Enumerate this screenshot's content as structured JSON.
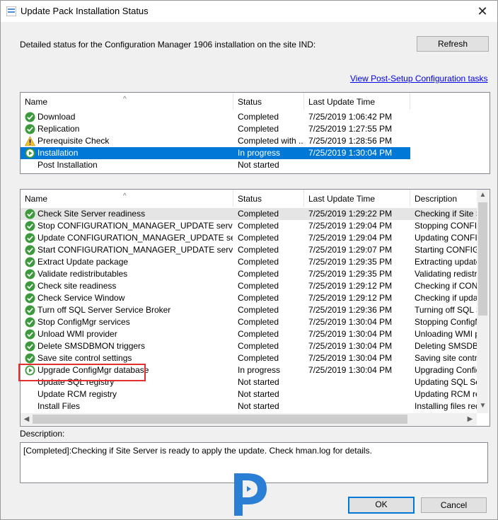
{
  "window": {
    "title": "Update Pack Installation Status",
    "close_glyph": "✕"
  },
  "status_text": "Detailed status for the Configuration Manager 1906 installation on the site IND:",
  "refresh_label": "Refresh",
  "post_setup_link": "View Post-Setup Configuration tasks",
  "top_list": {
    "columns": [
      "Name",
      "Status",
      "Last Update Time"
    ],
    "rows": [
      {
        "name": "Download",
        "status": "Completed",
        "time": "7/25/2019 1:06:42 PM",
        "icon": "check-icon"
      },
      {
        "name": "Replication",
        "status": "Completed",
        "time": "7/25/2019 1:27:55 PM",
        "icon": "check-icon"
      },
      {
        "name": "Prerequisite Check",
        "status": "Completed with ...",
        "time": "7/25/2019 1:28:56 PM",
        "icon": "warning-icon"
      },
      {
        "name": "Installation",
        "status": "In progress",
        "time": "7/25/2019 1:30:04 PM",
        "icon": "play-icon"
      },
      {
        "name": "Post Installation",
        "status": "Not started",
        "time": "",
        "icon": ""
      }
    ]
  },
  "bottom_list": {
    "columns": [
      "Name",
      "Status",
      "Last Update Time",
      "Description"
    ],
    "rows": [
      {
        "name": "Check Site Server readiness",
        "status": "Completed",
        "time": "7/25/2019 1:29:22 PM",
        "desc": "Checking if Site Se",
        "icon": "check-icon"
      },
      {
        "name": "Stop CONFIGURATION_MANAGER_UPDATE service",
        "status": "Completed",
        "time": "7/25/2019 1:29:04 PM",
        "desc": "Stopping CONFIGU",
        "icon": "check-icon"
      },
      {
        "name": "Update CONFIGURATION_MANAGER_UPDATE service",
        "status": "Completed",
        "time": "7/25/2019 1:29:04 PM",
        "desc": "Updating CONFIG",
        "icon": "check-icon"
      },
      {
        "name": "Start CONFIGURATION_MANAGER_UPDATE service",
        "status": "Completed",
        "time": "7/25/2019 1:29:07 PM",
        "desc": "Starting CONFIGU",
        "icon": "check-icon"
      },
      {
        "name": "Extract Update package",
        "status": "Completed",
        "time": "7/25/2019 1:29:35 PM",
        "desc": "Extracting update p",
        "icon": "check-icon"
      },
      {
        "name": "Validate redistributables",
        "status": "Completed",
        "time": "7/25/2019 1:29:35 PM",
        "desc": "Validating redistribu",
        "icon": "check-icon"
      },
      {
        "name": "Check site readiness",
        "status": "Completed",
        "time": "7/25/2019 1:29:12 PM",
        "desc": "Checking if CONFI",
        "icon": "check-icon"
      },
      {
        "name": "Check Service Window",
        "status": "Completed",
        "time": "7/25/2019 1:29:12 PM",
        "desc": "Checking if update",
        "icon": "check-icon"
      },
      {
        "name": "Turn off SQL Server Service Broker",
        "status": "Completed",
        "time": "7/25/2019 1:29:36 PM",
        "desc": "Turning off SQL Se",
        "icon": "check-icon"
      },
      {
        "name": "Stop ConfigMgr services",
        "status": "Completed",
        "time": "7/25/2019 1:30:04 PM",
        "desc": "Stopping ConfigMg",
        "icon": "check-icon"
      },
      {
        "name": "Unload WMI provider",
        "status": "Completed",
        "time": "7/25/2019 1:30:04 PM",
        "desc": "Unloading WMI pro",
        "icon": "check-icon"
      },
      {
        "name": "Delete SMSDBMON triggers",
        "status": "Completed",
        "time": "7/25/2019 1:30:04 PM",
        "desc": "Deleting SMSDBM",
        "icon": "check-icon"
      },
      {
        "name": "Save site control settings",
        "status": "Completed",
        "time": "7/25/2019 1:30:04 PM",
        "desc": "Saving site control",
        "icon": "check-icon"
      },
      {
        "name": "Upgrade ConfigMgr database",
        "status": "In progress",
        "time": "7/25/2019 1:30:04 PM",
        "desc": "Upgrading ConfigM",
        "icon": "play-icon"
      },
      {
        "name": "Update SQL registry",
        "status": "Not started",
        "time": "",
        "desc": "Updating SQL Ser",
        "icon": ""
      },
      {
        "name": "Update RCM registry",
        "status": "Not started",
        "time": "",
        "desc": "Updating RCM reg",
        "icon": ""
      },
      {
        "name": "Install Files",
        "status": "Not started",
        "time": "",
        "desc": "Installing files requ",
        "icon": ""
      }
    ]
  },
  "description_label": "Description:",
  "description_text": "[Completed]:Checking if Site Server is ready to apply the update. Check hman.log for details.",
  "ok_label": "OK",
  "cancel_label": "Cancel",
  "colors": {
    "selection": "#0078d7",
    "link": "#0000ee",
    "highlight_box": "#e03030",
    "logo": "#2a7fd4"
  }
}
